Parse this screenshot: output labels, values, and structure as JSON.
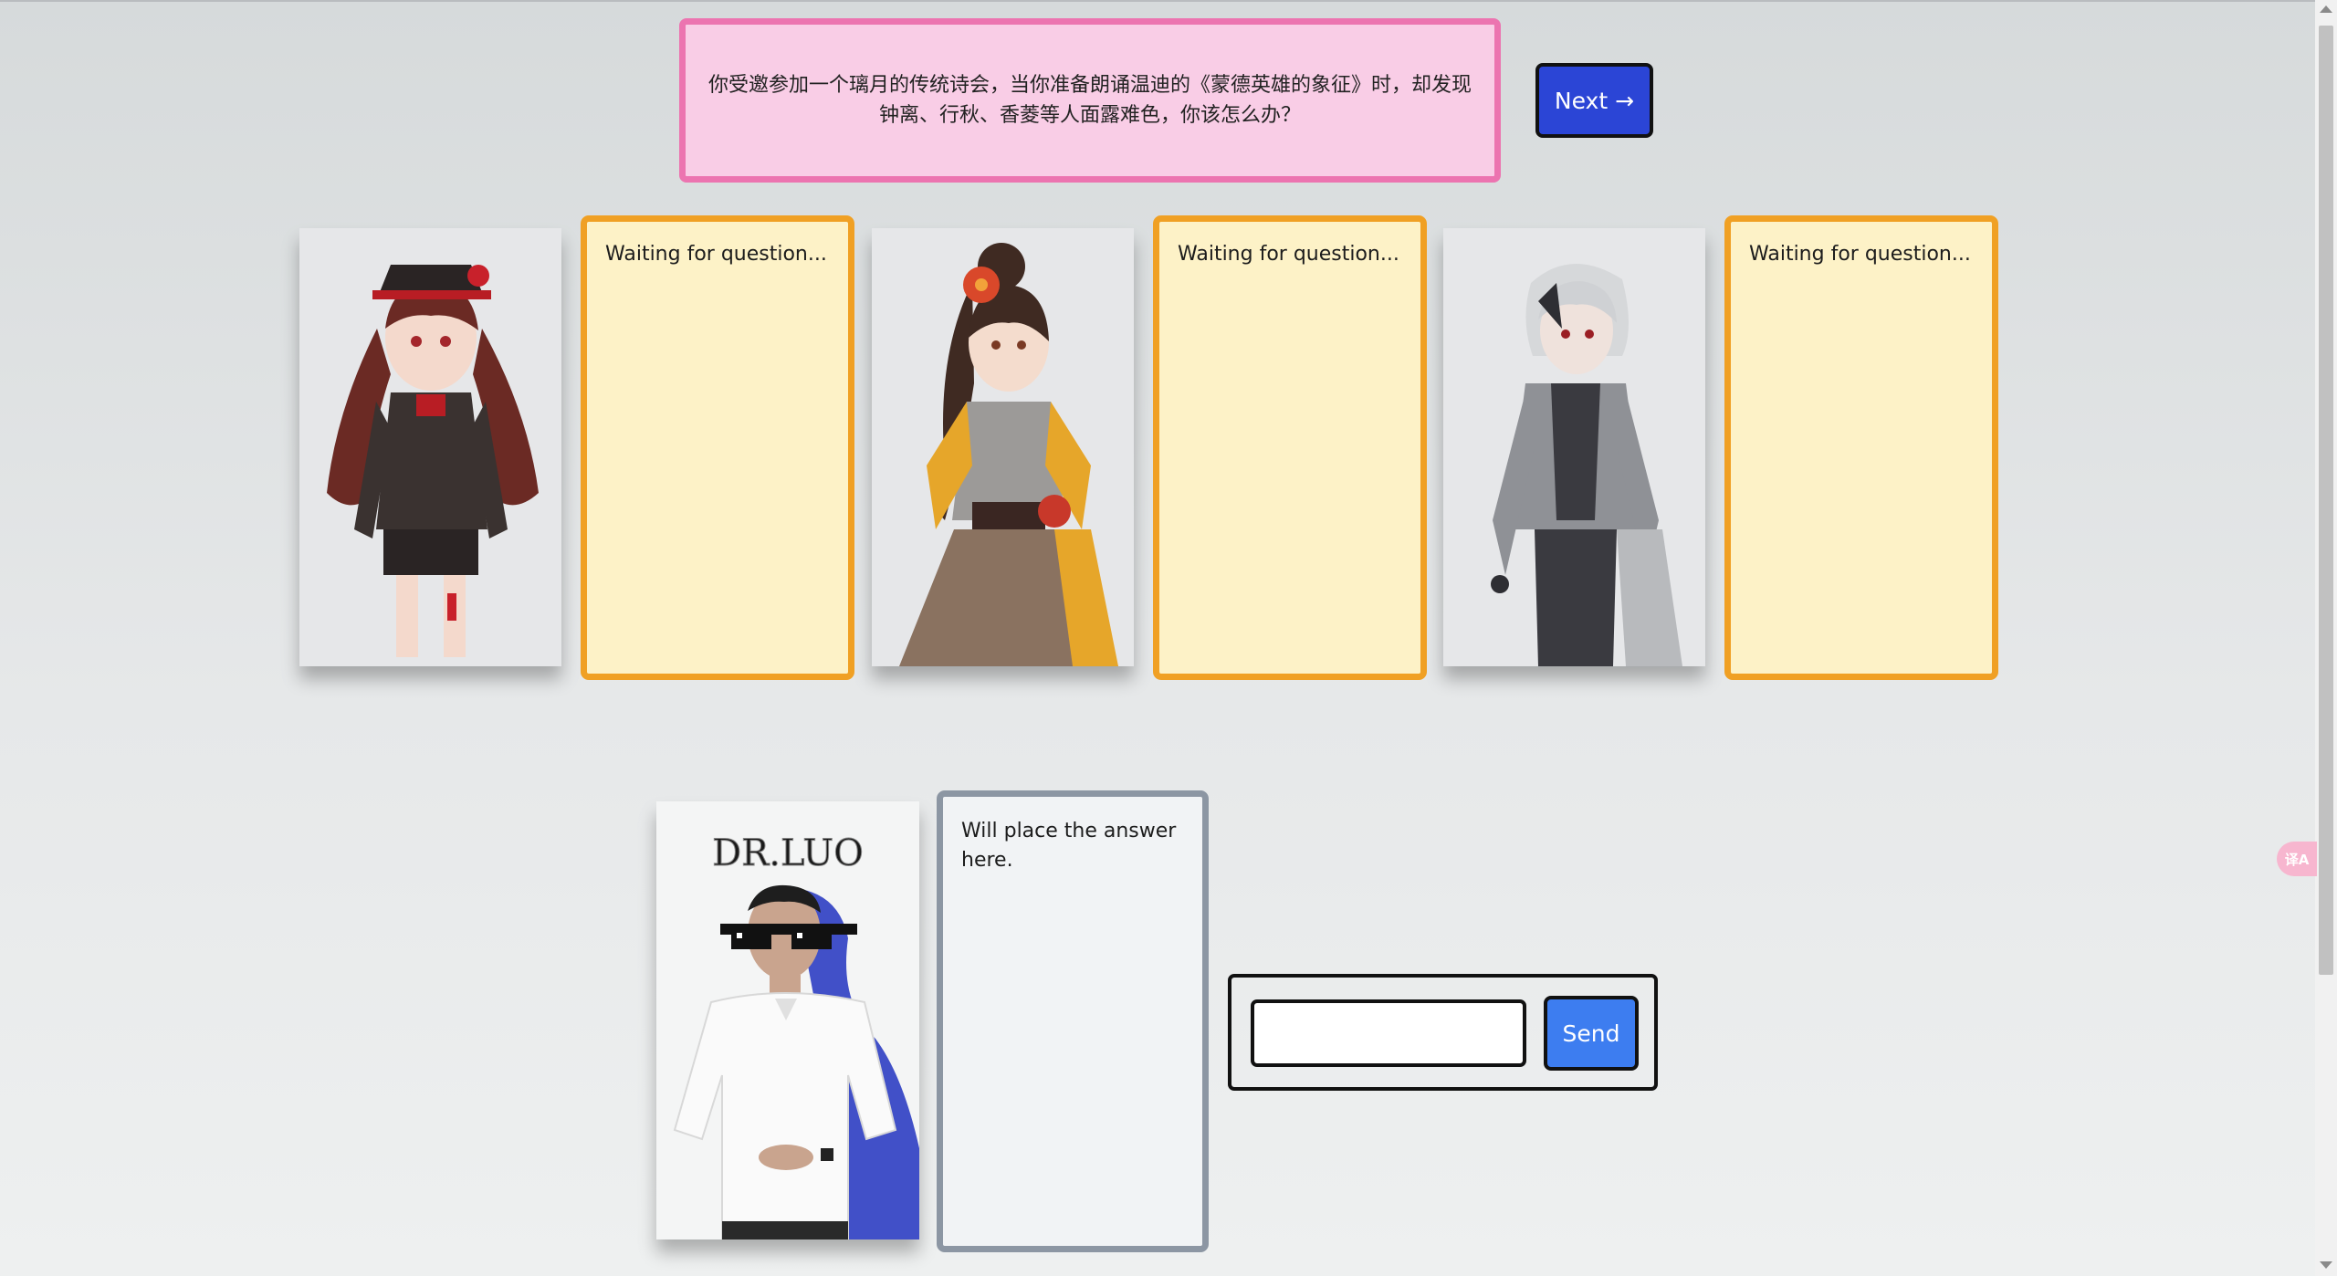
{
  "question": {
    "text": "你受邀参加一个璃月的传统诗会，当你准备朗诵温迪的《蒙德英雄的象征》时，却发现钟离、行秋、香菱等人面露难色，你该怎么办？"
  },
  "navigation": {
    "next_label": "Next",
    "next_arrow": "→"
  },
  "characters": [
    {
      "answer": "Waiting for question..."
    },
    {
      "answer": "Waiting for question..."
    },
    {
      "answer": "Waiting for question..."
    }
  ],
  "dr_luo": {
    "portrait_caption": "DR.LUO",
    "answer": "Will place the answer here."
  },
  "chat": {
    "input_value": "",
    "input_placeholder": "",
    "send_label": "Send"
  },
  "translate_widget": {
    "icon": "translate-icon",
    "glyph": "译A"
  },
  "colors": {
    "question_bg": "#f9cde6",
    "question_border": "#ec74b0",
    "next_button": "#2b45d6",
    "card_bg": "#fdf2c7",
    "card_border": "#f0a024",
    "drluo_card_border": "#8c96a3",
    "send_button": "#3d7df0"
  }
}
